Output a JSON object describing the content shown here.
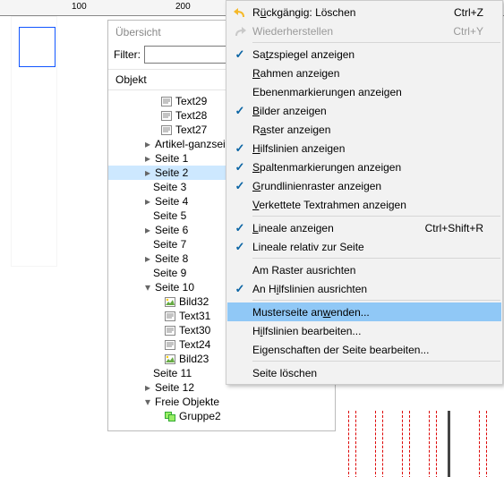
{
  "ruler": {
    "tick_100": "100",
    "tick_200": "200"
  },
  "overview": {
    "title": "Übersicht",
    "filter_label": "Filter:",
    "filter_value": "",
    "header": "Objekt",
    "items": {
      "text29": "Text29",
      "text28": "Text28",
      "text27": "Text27",
      "artikel": "Artikel-ganzseitig",
      "seite1": "Seite 1",
      "seite2": "Seite 2",
      "seite3": "Seite 3",
      "seite4": "Seite 4",
      "seite5": "Seite 5",
      "seite6": "Seite 6",
      "seite7": "Seite 7",
      "seite8": "Seite 8",
      "seite9": "Seite 9",
      "seite10": "Seite 10",
      "bild32": "Bild32",
      "text31": "Text31",
      "text30": "Text30",
      "text24": "Text24",
      "bild23": "Bild23",
      "seite11": "Seite 11",
      "seite12": "Seite 12",
      "freie": "Freie Objekte",
      "gruppe2": "Gruppe2"
    }
  },
  "menu": {
    "undo": {
      "label_pre": "R",
      "label_u": "ü",
      "label_post": "ckgängig: Löschen",
      "shortcut": "Ctrl+Z"
    },
    "redo": {
      "label": "Wiederherstellen",
      "shortcut": "Ctrl+Y"
    },
    "satzsp": {
      "pre": "Sa",
      "u": "t",
      "post": "zspiegel anzeigen"
    },
    "rahmen": {
      "pre": "",
      "u": "R",
      "post": "ahmen anzeigen"
    },
    "ebenen": {
      "label": "Ebenenmarkierungen anzeigen"
    },
    "bilder": {
      "pre": "",
      "u": "B",
      "post": "ilder anzeigen"
    },
    "raster": {
      "pre": "R",
      "u": "a",
      "post": "ster anzeigen"
    },
    "hilfs": {
      "pre": "",
      "u": "H",
      "post": "ilfslinien anzeigen"
    },
    "spalten": {
      "pre": "",
      "u": "S",
      "post": "paltenmarkierungen anzeigen"
    },
    "grund": {
      "pre": "",
      "u": "G",
      "post": "rundlinienraster anzeigen"
    },
    "verkettete": {
      "pre": "",
      "u": "V",
      "post": "erkettete Textrahmen anzeigen"
    },
    "lineale": {
      "pre": "",
      "u": "L",
      "post": "ineale anzeigen",
      "shortcut": "Ctrl+Shift+R"
    },
    "lineale_rel": {
      "label": "Lineale relativ zur Seite"
    },
    "amraster": {
      "label": "Am Raster ausrichten"
    },
    "anhilfs": {
      "pre": "An H",
      "u": "i",
      "post": "lfslinien ausrichten"
    },
    "muster": {
      "pre": "Musterseite an",
      "u": "w",
      "post": "enden..."
    },
    "hilfsbear": {
      "pre": "H",
      "u": "i",
      "post": "lfslinien bearbeiten..."
    },
    "eigen": {
      "label": "Eigenschaften der Seite bearbeiten..."
    },
    "loeschen": {
      "label": "Seite löschen"
    }
  }
}
